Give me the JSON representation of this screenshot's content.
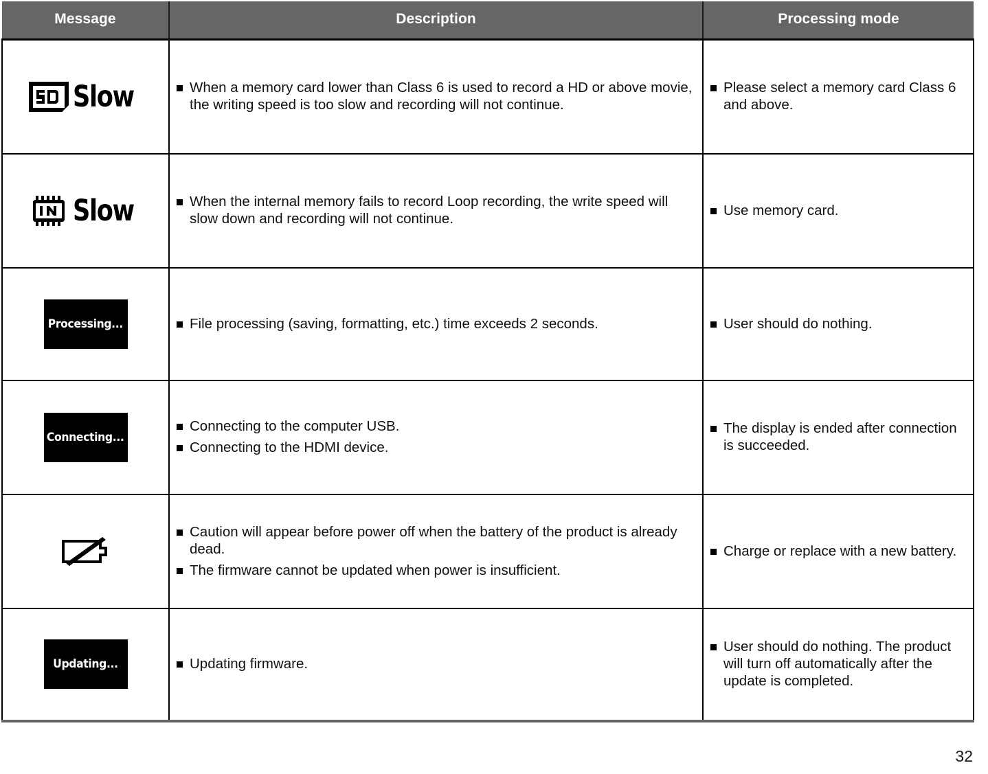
{
  "document": {
    "page_number": "32",
    "accent_header_bg": "#666666",
    "header_text_color": "#ffffff",
    "border_color": "#000000"
  },
  "table": {
    "headers": {
      "message": "Message",
      "description": "Description",
      "processing_mode": "Processing mode"
    },
    "rows": [
      {
        "icon": {
          "type": "sd-slow-icon",
          "badge_label": "SD",
          "word": "Slow"
        },
        "description": [
          "When a memory card lower than Class 6 is used to record a HD or above movie, the writing speed is too slow and recording will not continue."
        ],
        "processing_mode": [
          "Please select a memory card Class 6 and above."
        ]
      },
      {
        "icon": {
          "type": "internal-memory-slow-icon",
          "badge_label": "IN",
          "word": "Slow"
        },
        "description": [
          "When the internal memory fails to record Loop recording, the write speed will slow down and recording will not continue."
        ],
        "processing_mode": [
          "Use memory card."
        ]
      },
      {
        "icon": {
          "type": "lcd-message-icon",
          "lcd_text": "Processing..."
        },
        "description": [
          "File processing (saving, formatting, etc.) time exceeds 2 seconds."
        ],
        "processing_mode": [
          "User should do nothing."
        ]
      },
      {
        "icon": {
          "type": "lcd-message-icon",
          "lcd_text": "Connecting..."
        },
        "description": [
          "Connecting to the computer USB.",
          "Connecting to the HDMI device."
        ],
        "processing_mode": [
          "The display is ended after connection is succeeded."
        ]
      },
      {
        "icon": {
          "type": "battery-empty-icon"
        },
        "description": [
          "Caution will appear before power off when the battery of the product is already dead.",
          "The firmware cannot be updated when power is insufficient."
        ],
        "processing_mode": [
          "Charge or replace with a new battery."
        ]
      },
      {
        "icon": {
          "type": "lcd-message-icon",
          "lcd_text": "Updating..."
        },
        "description": [
          "Updating firmware."
        ],
        "processing_mode": [
          "User should do nothing. The product will turn off automatically after the update is completed."
        ]
      }
    ]
  }
}
